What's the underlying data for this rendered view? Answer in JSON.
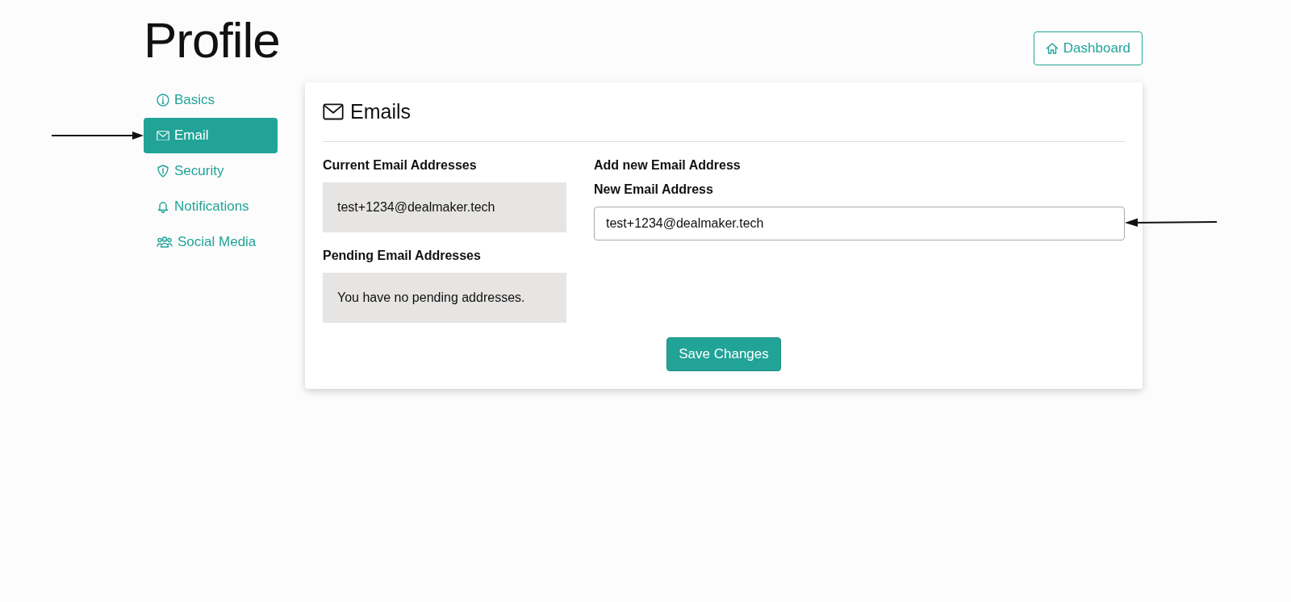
{
  "page_title": "Profile",
  "dashboard_button": "Dashboard",
  "sidebar": {
    "items": [
      {
        "label": "Basics",
        "selected": false
      },
      {
        "label": "Email",
        "selected": true,
        "pointed_at": true
      },
      {
        "label": "Security",
        "selected": false
      },
      {
        "label": "Notifications",
        "selected": false
      },
      {
        "label": "Social Media",
        "selected": false
      }
    ]
  },
  "card": {
    "title": "Emails",
    "current": {
      "label": "Current Email Addresses",
      "value": "test+1234@dealmaker.tech"
    },
    "pending": {
      "label": "Pending Email Addresses",
      "value": "You have no pending addresses."
    },
    "add": {
      "heading": "Add new Email Address",
      "field_label": "New Email Address",
      "value": "test+1234@dealmaker.tech",
      "pointed_at": true
    },
    "save_button": "Save Changes"
  }
}
